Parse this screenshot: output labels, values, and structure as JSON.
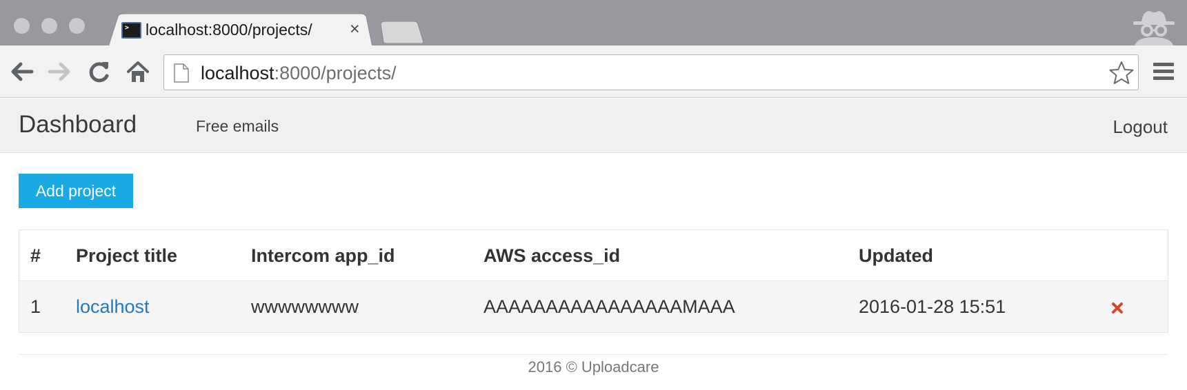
{
  "browser": {
    "tab_title": "localhost:8000/projects/",
    "tab_close": "×",
    "url_host": "localhost",
    "url_rest": ":8000/projects/"
  },
  "navbar": {
    "brand": "Dashboard",
    "links": [
      "Free emails"
    ],
    "logout": "Logout"
  },
  "main": {
    "add_button": "Add project",
    "table": {
      "headers": [
        "#",
        "Project title",
        "Intercom app_id",
        "AWS access_id",
        "Updated"
      ],
      "rows": [
        {
          "num": "1",
          "title": "localhost",
          "intercom_app_id": "wwwwwwww",
          "aws_access_id": "AAAAAAAAAAAAAAAAMAAA",
          "updated": "2016-01-28 15:51"
        }
      ]
    }
  },
  "footer": "2016 © Uploadcare",
  "colors": {
    "accent": "#19a9e5",
    "link": "#1f7ac6",
    "delete": "#d9472b"
  },
  "icons": [
    "back-arrow-icon",
    "forward-arrow-icon",
    "reload-icon",
    "home-icon",
    "page-icon",
    "star-icon",
    "hamburger-menu-icon",
    "incognito-icon",
    "delete-icon"
  ]
}
